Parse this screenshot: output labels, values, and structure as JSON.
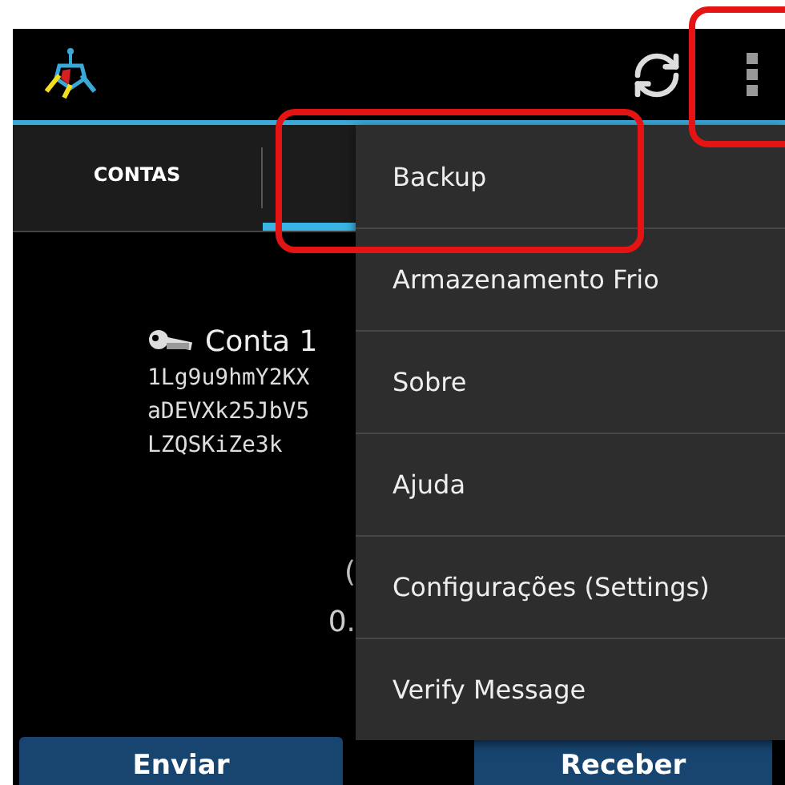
{
  "tabs": [
    {
      "label": "CONTAS",
      "selected": false
    },
    {
      "selected": true
    }
  ],
  "account": {
    "name": "Conta 1",
    "address_lines": [
      "1Lg9u9hmY2KX",
      "aDEVXk25JbV5",
      "LZQSKiZe3k"
    ]
  },
  "balance": {
    "line_1": "(",
    "line_2": "0."
  },
  "menu": {
    "items": [
      {
        "label": "Backup"
      },
      {
        "label": "Armazenamento Frio"
      },
      {
        "label": "Sobre"
      },
      {
        "label": "Ajuda"
      },
      {
        "label": "Configurações (Settings)"
      },
      {
        "label": "Verify Message"
      }
    ]
  },
  "buttons": [
    {
      "label": "Enviar"
    },
    {
      "label": "Receber"
    }
  ]
}
